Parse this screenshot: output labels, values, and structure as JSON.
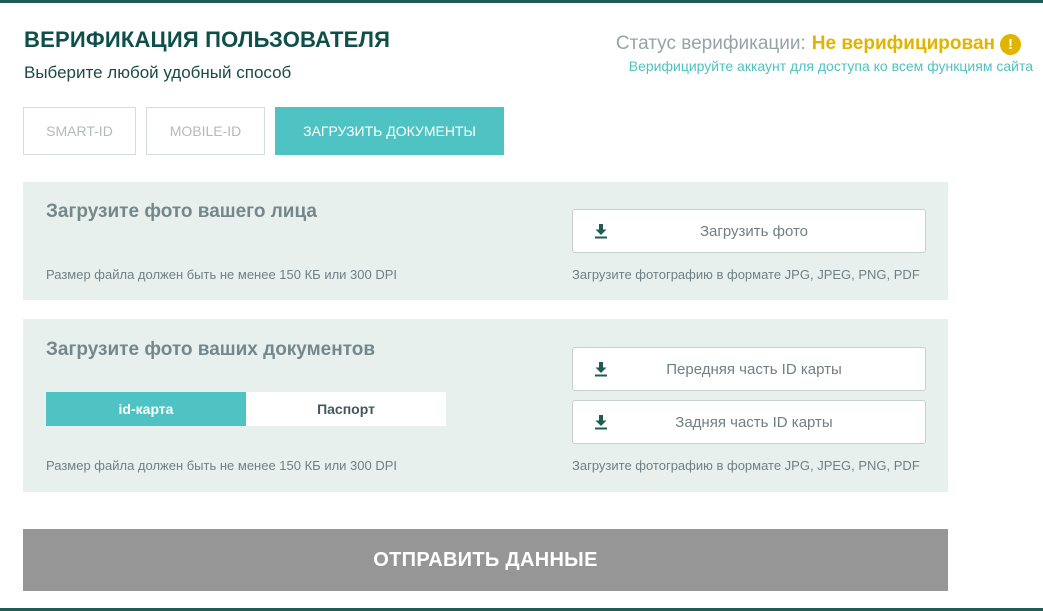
{
  "header": {
    "title": "ВЕРИФИКАЦИЯ ПОЛЬЗОВАТЕЛЯ",
    "subtitle": "Выберите любой удобный способ"
  },
  "status": {
    "label": "Статус верификации:",
    "value": "Не верифицирован",
    "icon": "warning-icon",
    "icon_glyph": "!",
    "note": "Верифицируйте аккаунт для доступа ко всем функциям сайта"
  },
  "methods": [
    {
      "label": "SMART-ID",
      "active": false
    },
    {
      "label": "MOBILE-ID",
      "active": false
    },
    {
      "label": "ЗАГРУЗИТЬ ДОКУМЕНТЫ",
      "active": true
    }
  ],
  "face_section": {
    "title": "Загрузите фото вашего лица",
    "size_hint": "Размер файла должен быть не менее 150 КБ или 300 DPI",
    "format_hint": "Загрузите фотографию в формате JPG, JPEG, PNG, PDF",
    "upload_button": "Загрузить фото"
  },
  "docs_section": {
    "title": "Загрузите фото ваших документов",
    "doc_types": [
      {
        "label": "id-карта",
        "active": true
      },
      {
        "label": "Паспорт",
        "active": false
      }
    ],
    "front_button": "Передняя часть ID карты",
    "back_button": "Задняя часть ID карты",
    "size_hint": "Размер файла должен быть не менее 150 КБ или 300 DPI",
    "format_hint": "Загрузите фотографию в формате JPG, JPEG, PNG, PDF"
  },
  "submit": {
    "label": "ОТПРАВИТЬ ДАННЫЕ"
  },
  "colors": {
    "accent": "#4fc3c3",
    "title": "#0f4f4a",
    "warning": "#e0b400",
    "panel_bg": "#e8f0ee",
    "submit_bg": "#969696"
  }
}
